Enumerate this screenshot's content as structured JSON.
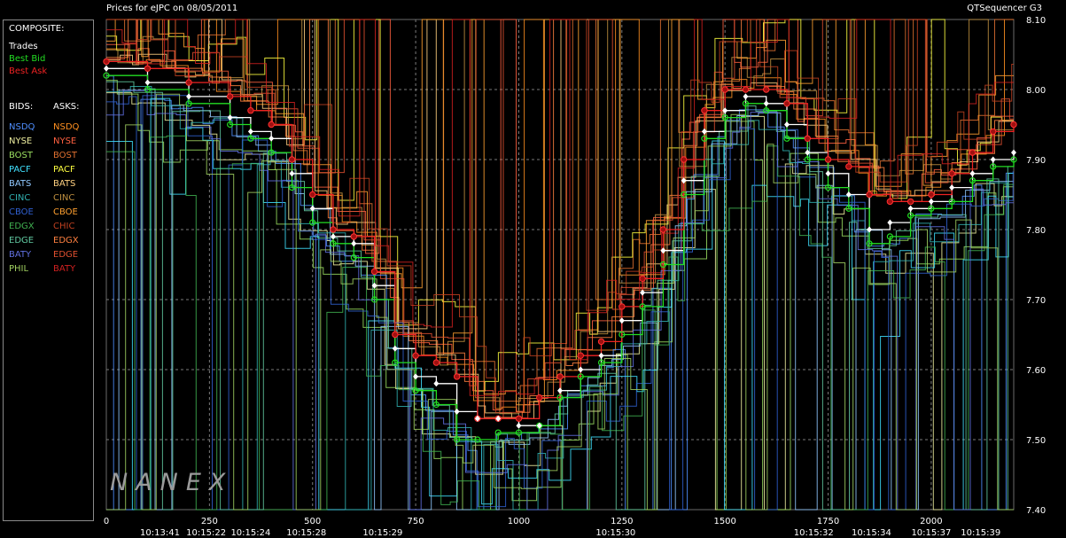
{
  "header": {
    "title": "Prices for eJPC on 08/05/2011",
    "app_name": "QTSequencer G3"
  },
  "legend": {
    "composite_title": "COMPOSITE:",
    "composite_items": [
      {
        "label": "Trades",
        "color": "#ffffff"
      },
      {
        "label": "Best Bid",
        "color": "#22dd22"
      },
      {
        "label": "Best Ask",
        "color": "#ee2222"
      }
    ],
    "bids_title": "BIDS:",
    "asks_title": "ASKS:",
    "bids": [
      {
        "label": "NSDQ",
        "color": "#4f8fff"
      },
      {
        "label": "NYSE",
        "color": "#f0f0a0"
      },
      {
        "label": "BOST",
        "color": "#9ade60"
      },
      {
        "label": "PACF",
        "color": "#40e0ff"
      },
      {
        "label": "BATS",
        "color": "#90c8ff"
      },
      {
        "label": "CINC",
        "color": "#30b0b0"
      },
      {
        "label": "CBOE",
        "color": "#3060d0"
      },
      {
        "label": "EDGX",
        "color": "#40b050"
      },
      {
        "label": "EDGE",
        "color": "#60c8a0"
      },
      {
        "label": "BATY",
        "color": "#6070e0"
      },
      {
        "label": "PHIL",
        "color": "#a0d060"
      }
    ],
    "asks": [
      {
        "label": "NSDQ",
        "color": "#ff9020"
      },
      {
        "label": "NYSE",
        "color": "#ff6040"
      },
      {
        "label": "BOST",
        "color": "#e07030"
      },
      {
        "label": "PACF",
        "color": "#ffff40"
      },
      {
        "label": "BATS",
        "color": "#ffd080"
      },
      {
        "label": "CINC",
        "color": "#c09040"
      },
      {
        "label": "CBOE",
        "color": "#ffa030"
      },
      {
        "label": "CHIC",
        "color": "#c04020"
      },
      {
        "label": "EDGX",
        "color": "#ff8040"
      },
      {
        "label": "EDGE",
        "color": "#e05030"
      },
      {
        "label": "BATY",
        "color": "#d02020"
      }
    ]
  },
  "watermark": "NANEX",
  "chart_data": {
    "type": "line",
    "ylim": [
      7.4,
      8.1
    ],
    "xlim": [
      0,
      2200
    ],
    "y_ticks": [
      "8.10",
      "8.00",
      "7.90",
      "7.80",
      "7.70",
      "7.60",
      "7.50",
      "7.40"
    ],
    "x_ticks": [
      "0",
      "250",
      "500",
      "750",
      "1000",
      "1250",
      "1500",
      "1750",
      "2000"
    ],
    "time_labels": [
      {
        "x": 130,
        "label": "10:13:41"
      },
      {
        "x": 242,
        "label": "10:15:22"
      },
      {
        "x": 350,
        "label": "10:15:24"
      },
      {
        "x": 485,
        "label": "10:15:28"
      },
      {
        "x": 670,
        "label": "10:15:29"
      },
      {
        "x": 1235,
        "label": "10:15:30"
      },
      {
        "x": 1715,
        "label": "10:15:32"
      },
      {
        "x": 1855,
        "label": "10:15:34"
      },
      {
        "x": 2000,
        "label": "10:15:37"
      },
      {
        "x": 2120,
        "label": "10:15:39"
      }
    ],
    "grid": true,
    "series": [
      {
        "name": "Trades",
        "color": "#ffffff",
        "x": [
          0,
          100,
          200,
          300,
          350,
          400,
          450,
          500,
          550,
          600,
          650,
          700,
          750,
          800,
          850,
          900,
          950,
          1000,
          1050,
          1100,
          1150,
          1200,
          1250,
          1300,
          1350,
          1400,
          1450,
          1500,
          1550,
          1600,
          1650,
          1700,
          1750,
          1800,
          1850,
          1900,
          1950,
          2000,
          2050,
          2100,
          2150,
          2200
        ],
        "y": [
          8.03,
          8.01,
          7.99,
          7.96,
          7.94,
          7.93,
          7.88,
          7.83,
          7.79,
          7.78,
          7.72,
          7.63,
          7.59,
          7.58,
          7.54,
          7.53,
          7.53,
          7.52,
          7.52,
          7.57,
          7.6,
          7.62,
          7.67,
          7.71,
          7.77,
          7.87,
          7.94,
          7.97,
          7.99,
          7.98,
          7.95,
          7.91,
          7.88,
          7.85,
          7.8,
          7.81,
          7.83,
          7.84,
          7.86,
          7.88,
          7.9,
          7.91
        ]
      },
      {
        "name": "Best Bid",
        "color": "#22dd22",
        "x": [
          0,
          100,
          200,
          300,
          350,
          400,
          450,
          500,
          550,
          600,
          650,
          700,
          750,
          800,
          850,
          900,
          950,
          1000,
          1050,
          1100,
          1150,
          1200,
          1250,
          1300,
          1350,
          1400,
          1450,
          1500,
          1550,
          1600,
          1650,
          1700,
          1750,
          1800,
          1850,
          1900,
          1950,
          2000,
          2050,
          2100,
          2150,
          2200
        ],
        "y": [
          8.02,
          8.0,
          7.98,
          7.95,
          7.93,
          7.91,
          7.86,
          7.81,
          7.78,
          7.76,
          7.7,
          7.61,
          7.57,
          7.55,
          7.5,
          7.5,
          7.51,
          7.51,
          7.52,
          7.56,
          7.59,
          7.61,
          7.65,
          7.69,
          7.75,
          7.85,
          7.93,
          7.96,
          7.98,
          7.97,
          7.93,
          7.9,
          7.86,
          7.83,
          7.78,
          7.79,
          7.82,
          7.83,
          7.84,
          7.87,
          7.89,
          7.9
        ]
      },
      {
        "name": "Best Ask",
        "color": "#ee2222",
        "x": [
          0,
          100,
          200,
          300,
          350,
          400,
          450,
          500,
          550,
          600,
          650,
          700,
          750,
          800,
          850,
          900,
          950,
          1000,
          1050,
          1100,
          1150,
          1200,
          1250,
          1300,
          1350,
          1400,
          1450,
          1500,
          1550,
          1600,
          1650,
          1700,
          1750,
          1800,
          1850,
          1900,
          1950,
          2000,
          2050,
          2100,
          2150,
          2200
        ],
        "y": [
          8.04,
          8.03,
          8.01,
          7.99,
          7.97,
          7.95,
          7.9,
          7.85,
          7.8,
          7.79,
          7.74,
          7.65,
          7.62,
          7.61,
          7.59,
          7.53,
          7.53,
          7.53,
          7.56,
          7.59,
          7.62,
          7.64,
          7.69,
          7.73,
          7.8,
          7.9,
          7.97,
          8.0,
          8.0,
          8.0,
          7.98,
          7.93,
          7.9,
          7.89,
          7.85,
          7.84,
          7.84,
          7.85,
          7.88,
          7.91,
          7.94,
          7.95
        ]
      }
    ]
  }
}
